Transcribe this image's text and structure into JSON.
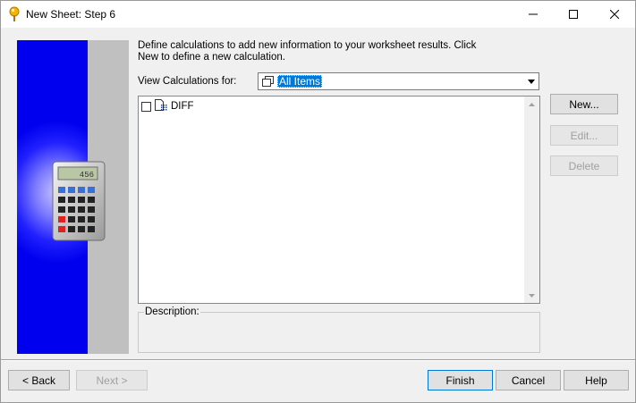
{
  "window": {
    "title": "New Sheet: Step 6"
  },
  "wizard": {
    "instruction": "Define calculations to add new information to your worksheet results. Click New to define a new calculation.",
    "instruction_line1": "Define calculations to add new information to your worksheet results. Click",
    "instruction_line2": "New to define a new calculation.",
    "calc_display": "456"
  },
  "view": {
    "label": "View Calculations for:",
    "selected": "All Items"
  },
  "calculations": {
    "items": [
      {
        "label": "DIFF",
        "checked": false
      }
    ]
  },
  "description": {
    "label": "Description:"
  },
  "side_buttons": {
    "new": "New...",
    "edit": "Edit...",
    "delete": "Delete"
  },
  "footer": {
    "back": "< Back",
    "next": "Next >",
    "finish": "Finish",
    "cancel": "Cancel",
    "help": "Help"
  },
  "colors": {
    "selection": "#0078d7",
    "wizard_blue": "#0000ee",
    "wizard_gray": "#c0c0c0"
  }
}
